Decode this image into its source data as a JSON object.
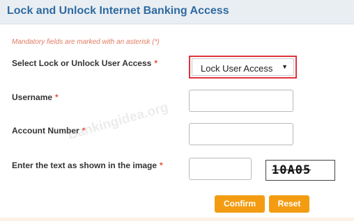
{
  "header": {
    "title": "Lock and Unlock Internet Banking Access"
  },
  "form": {
    "mandatory_note": "Mandatory fields are marked with an asterisk (*)",
    "required_marker": "*",
    "lock_select": {
      "label": "Select Lock or Unlock User Access",
      "value": "Lock User Access"
    },
    "username": {
      "label": "Username",
      "value": ""
    },
    "account_number": {
      "label": "Account Number",
      "value": ""
    },
    "captcha": {
      "label": "Enter the text as shown in the image",
      "value": "",
      "image_text": "10A05"
    }
  },
  "buttons": {
    "confirm": "Confirm",
    "reset": "Reset"
  },
  "watermark": "Bankingidea.org",
  "colors": {
    "header_text": "#2f6aa0",
    "button": "#f39c12",
    "highlight": "#e0333a",
    "required": "#e4533a"
  }
}
